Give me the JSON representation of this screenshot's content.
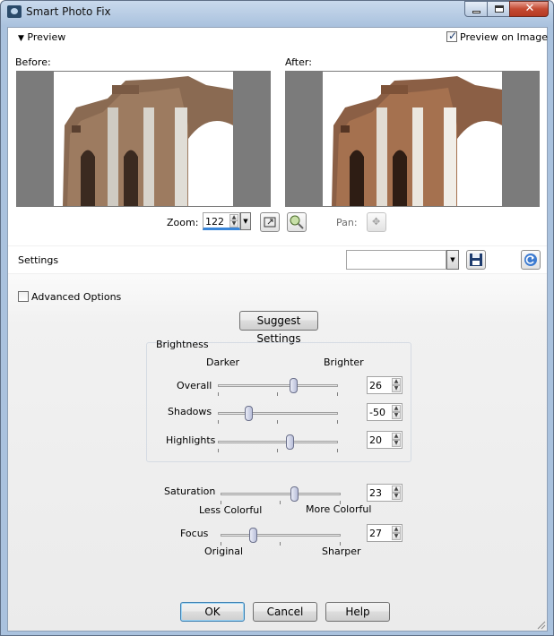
{
  "window": {
    "title": "Smart Photo Fix"
  },
  "preview": {
    "header_label": "Preview",
    "preview_on_image_label": "Preview on Image",
    "preview_on_image_checked": true,
    "before_label": "Before:",
    "after_label": "After:",
    "zoom_label": "Zoom:",
    "zoom_value": "122",
    "pan_label": "Pan:"
  },
  "settings": {
    "label": "Settings",
    "preset_value": "",
    "advanced_options_label": "Advanced Options",
    "advanced_options_checked": false,
    "suggest_button_label": "Suggest Settings"
  },
  "brightness": {
    "group_label": "Brightness",
    "darker_label": "Darker",
    "brighter_label": "Brighter",
    "overall": {
      "label": "Overall",
      "value": "26",
      "level": 0.63
    },
    "shadows": {
      "label": "Shadows",
      "value": "-50",
      "level": 0.25
    },
    "highlights": {
      "label": "Highlights",
      "value": "20",
      "level": 0.6
    }
  },
  "saturation": {
    "label": "Saturation",
    "value": "23",
    "level": 0.61,
    "less_label": "Less Colorful",
    "more_label": "More Colorful"
  },
  "focus": {
    "label": "Focus",
    "value": "27",
    "level": 0.27,
    "original_label": "Original",
    "sharper_label": "Sharper"
  },
  "buttons": {
    "ok": "OK",
    "cancel": "Cancel",
    "help": "Help"
  }
}
